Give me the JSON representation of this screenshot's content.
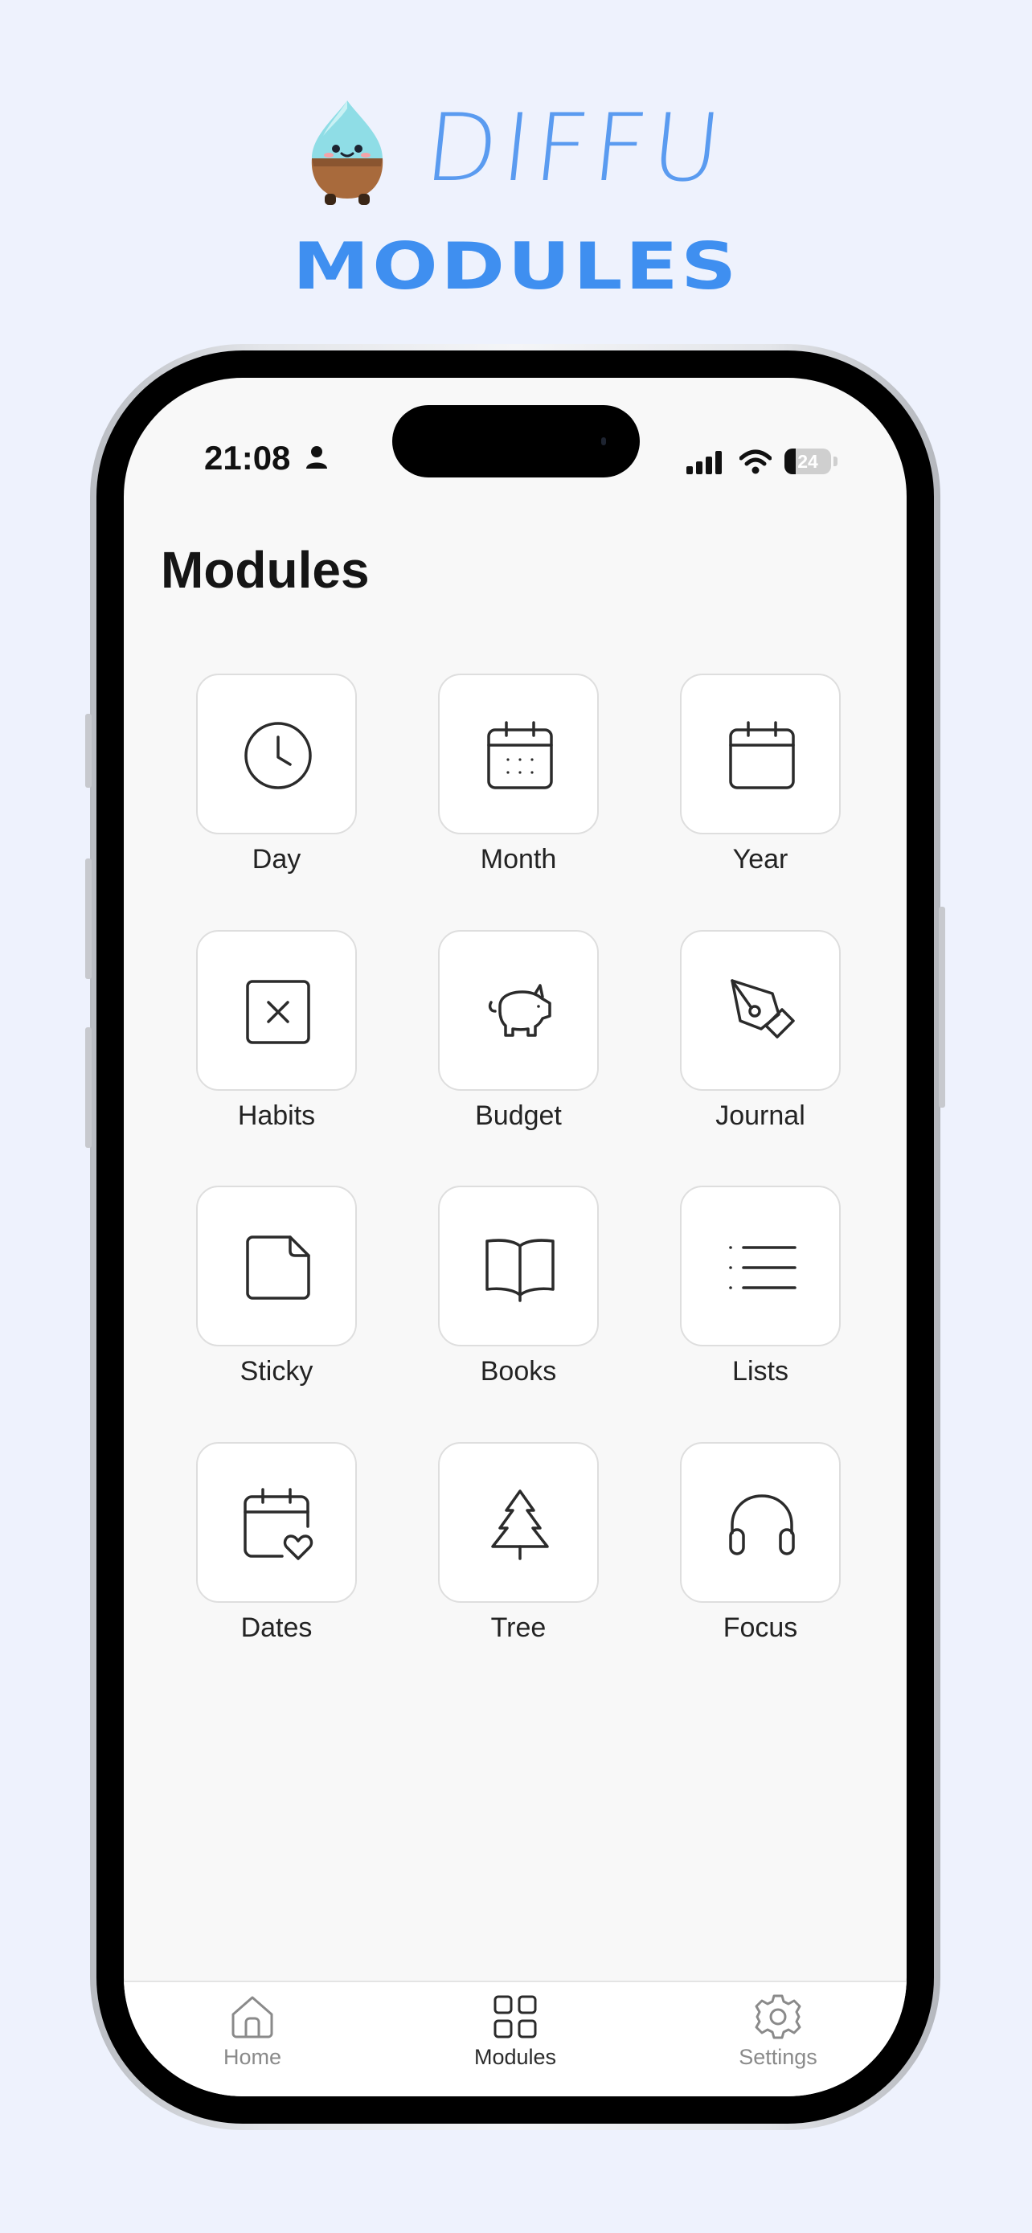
{
  "brand": {
    "name": "DIFFU",
    "heading": "MODULES"
  },
  "status_bar": {
    "time": "21:08",
    "battery": "24"
  },
  "screen_title": "Modules",
  "modules": [
    {
      "label": "Day",
      "icon": "clock-icon"
    },
    {
      "label": "Month",
      "icon": "calendar-dots-icon"
    },
    {
      "label": "Year",
      "icon": "calendar-icon"
    },
    {
      "label": "Habits",
      "icon": "checkbox-x-icon"
    },
    {
      "label": "Budget",
      "icon": "piggy-bank-icon"
    },
    {
      "label": "Journal",
      "icon": "pen-nib-icon"
    },
    {
      "label": "Sticky",
      "icon": "sticky-note-icon"
    },
    {
      "label": "Books",
      "icon": "open-book-icon"
    },
    {
      "label": "Lists",
      "icon": "list-icon"
    },
    {
      "label": "Dates",
      "icon": "calendar-heart-icon"
    },
    {
      "label": "Tree",
      "icon": "pine-tree-icon"
    },
    {
      "label": "Focus",
      "icon": "headphones-icon"
    }
  ],
  "tabs": [
    {
      "label": "Home",
      "icon": "home-icon",
      "active": false
    },
    {
      "label": "Modules",
      "icon": "grid-icon",
      "active": true
    },
    {
      "label": "Settings",
      "icon": "gear-icon",
      "active": false
    }
  ],
  "colors": {
    "background": "#eef2fd",
    "brand_blue": "#3f8ff0",
    "icon_stroke": "#2b2b2b"
  }
}
